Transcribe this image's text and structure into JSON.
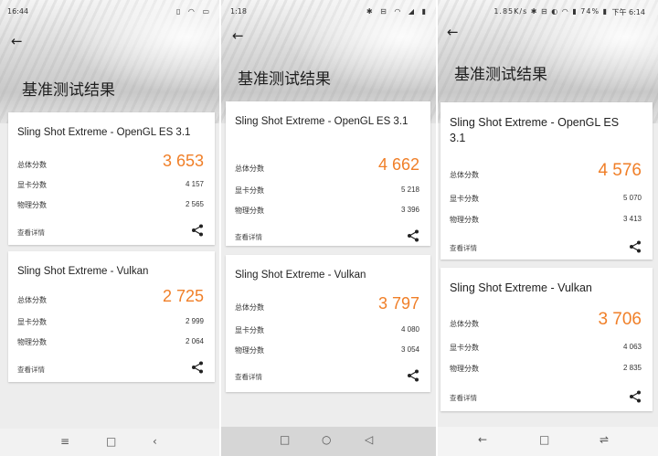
{
  "colors": {
    "accent": "#f07f28"
  },
  "phones": [
    {
      "status_time": "16:44",
      "status_icons": "▯ ◠ ▭",
      "title": "基准测试结果",
      "opengl": {
        "title": "Sling Shot Extreme - OpenGL ES 3.1",
        "total_label": "总体分数",
        "total": "3 653",
        "gpu_label": "显卡分数",
        "gpu": "4 157",
        "physics_label": "物理分数",
        "physics": "2 565",
        "details": "查看详情"
      },
      "vulkan": {
        "title": "Sling Shot Extreme - Vulkan",
        "total_label": "总体分数",
        "total": "2 725",
        "gpu_label": "显卡分数",
        "gpu": "2 999",
        "physics_label": "物理分数",
        "physics": "2 064",
        "details": "查看详情"
      },
      "nav": {
        "menu": "≡",
        "home": "□",
        "back": "‹"
      }
    },
    {
      "status_time": "1:18",
      "status_icons": "✱ ⊟ ◠ ◢ ▮",
      "title": "基准测试结果",
      "opengl": {
        "title": "Sling Shot Extreme - OpenGL ES 3.1",
        "total_label": "总体分数",
        "total": "4 662",
        "gpu_label": "显卡分数",
        "gpu": "5 218",
        "physics_label": "物理分数",
        "physics": "3 396",
        "details": "查看详情"
      },
      "vulkan": {
        "title": "Sling Shot Extreme - Vulkan",
        "total_label": "总体分数",
        "total": "3 797",
        "gpu_label": "显卡分数",
        "gpu": "4 080",
        "physics_label": "物理分数",
        "physics": "3 054",
        "details": "查看详情"
      },
      "nav": {
        "menu": "□",
        "home": "○",
        "back": "◁"
      }
    },
    {
      "status_time": "下午 6:14",
      "status_icons": "1.85K/s ✱ ⊟ ◐ ◠ ▮ 74% ▮",
      "title": "基准测试结果",
      "opengl": {
        "title": "Sling Shot Extreme - OpenGL ES 3.1",
        "total_label": "总体分数",
        "total": "4 576",
        "gpu_label": "显卡分数",
        "gpu": "5 070",
        "physics_label": "物理分数",
        "physics": "3 413",
        "details": "查看详情"
      },
      "vulkan": {
        "title": "Sling Shot Extreme - Vulkan",
        "total_label": "总体分数",
        "total": "3 706",
        "gpu_label": "显卡分数",
        "gpu": "4 063",
        "physics_label": "物理分数",
        "physics": "2 835",
        "details": "查看详情"
      },
      "nav": {
        "menu": "←",
        "home": "□",
        "back": "⇌"
      }
    }
  ]
}
